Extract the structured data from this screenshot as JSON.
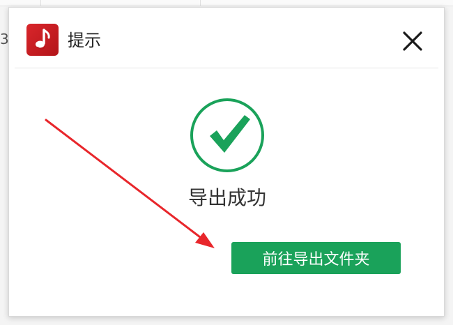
{
  "backdrop": {
    "partial_glyph": "3"
  },
  "dialog": {
    "title": "提示",
    "status_message": "导出成功",
    "primary_button_label": "前往导出文件夹"
  },
  "icons": {
    "app_logo": "music-note-icon",
    "close": "close-icon",
    "success": "check-circle-icon",
    "annotation_arrow": "red-arrow-annotation"
  },
  "colors": {
    "success_green": "#1aa25a",
    "logo_red": "#c91d22",
    "annotation_red": "#e8262b"
  }
}
